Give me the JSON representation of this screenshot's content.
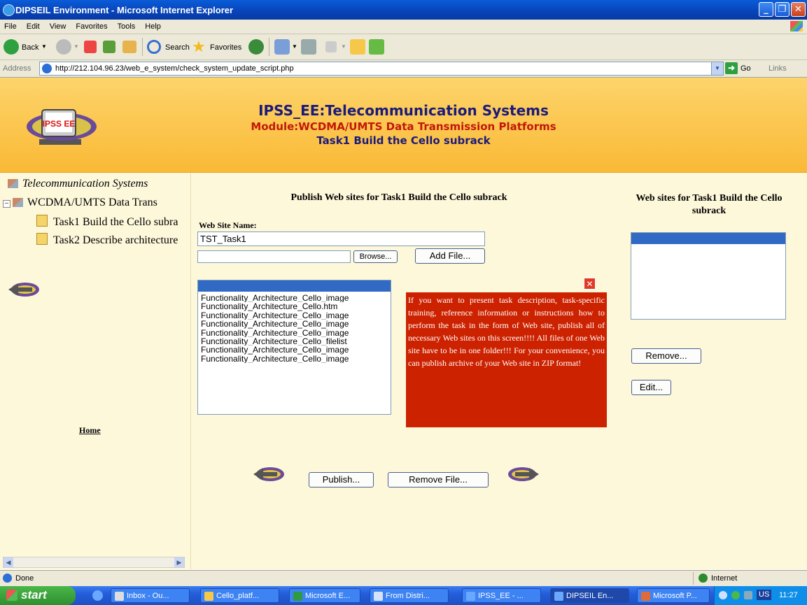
{
  "window": {
    "title": "DIPSEIL Environment - Microsoft Internet Explorer"
  },
  "menu": [
    "File",
    "Edit",
    "View",
    "Favorites",
    "Tools",
    "Help"
  ],
  "toolbar": {
    "back": "Back",
    "search": "Search",
    "favorites": "Favorites"
  },
  "address": {
    "label": "Address",
    "url": "http://212.104.96.23/web_e_system/check_system_update_script.php",
    "go": "Go",
    "links": "Links"
  },
  "header": {
    "title": "IPSS_EE:Telecommunication Systems",
    "module": "Module:WCDMA/UMTS Data Transmission Platforms",
    "task": "Task1 Build the Cello subrack",
    "logo_text": "IPSS EE"
  },
  "tree": {
    "root": "Telecommunication Systems",
    "module": "WCDMA/UMTS Data Trans",
    "items": [
      "Task1 Build the Cello subra",
      "Task2 Describe architecture"
    ]
  },
  "left": {
    "home": "Home"
  },
  "main": {
    "publish_heading": "Publish Web sites for Task1 Build the Cello subrack",
    "site_name_label": "Web Site Name:",
    "site_name_value": "TST_Task1",
    "browse": "Browse...",
    "add_file": "Add File...",
    "files": [
      "Functionality_Architecture_Cello_image",
      "Functionality_Architecture_Cello.htm",
      "Functionality_Architecture_Cello_image",
      "Functionality_Architecture_Cello_image",
      "Functionality_Architecture_Cello_image",
      "Functionality_Architecture_Cello_filelist",
      "Functionality_Architecture_Cello_image",
      "Functionality_Architecture_Cello_image"
    ],
    "tooltip": "If you want to present task description, task-specific training, reference information or instructions how to perform the task in the form of Web site, publish all of necessary Web sites on this screen!!!! All files of one Web site have to be in one folder!!! For your convenience, you can publish archive of your Web site in ZIP format!",
    "publish": "Publish...",
    "remove_file": "Remove File..."
  },
  "right": {
    "heading": "Web sites for Task1 Build the Cello subrack",
    "remove": "Remove...",
    "edit": "Edit..."
  },
  "status": {
    "text": "Done",
    "zone": "Internet"
  },
  "taskbar": {
    "start": "start",
    "tasks": [
      "Inbox - Ou...",
      "Cello_platf...",
      "Microsoft E...",
      "From Distri...",
      "IPSS_EE - ...",
      "DIPSEIL En...",
      "Microsoft P..."
    ],
    "lang": "US",
    "clock": "11:27"
  }
}
